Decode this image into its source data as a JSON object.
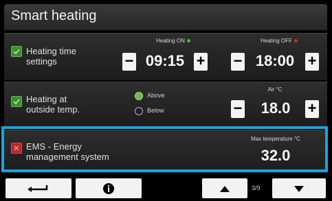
{
  "title": "Smart heating",
  "rows": {
    "time_settings": {
      "label_line1": "Heating time",
      "label_line2": "settings",
      "checked": true,
      "heating_on_label": "Heating ON",
      "heating_on_value": "09:15",
      "heating_off_label": "Heating OFF",
      "heating_off_value": "18:00",
      "on_dot_color": "#39c23a",
      "off_dot_color": "#e22222"
    },
    "outside_temp": {
      "label_line1": "Heating at",
      "label_line2": "outside temp.",
      "checked": true,
      "option_above": "Above",
      "option_below": "Below",
      "selected": "Above",
      "air_label": "Air °C",
      "air_value": "18.0"
    },
    "ems": {
      "label_line1": "EMS - Energy",
      "label_line2": "management system",
      "checked": false,
      "max_temp_label": "Max temperature °C",
      "max_temp_value": "32.0"
    }
  },
  "buttons": {
    "minus": "−",
    "plus": "+"
  },
  "navigation": {
    "back_icon": "return-arrow-icon",
    "info_icon": "info-icon",
    "up_icon": "arrow-up-icon",
    "down_icon": "arrow-down-icon",
    "page": "3/9"
  },
  "colors": {
    "highlight": "#1aa3df",
    "checked": "#3a8f2a",
    "unchecked": "#c0252b"
  }
}
